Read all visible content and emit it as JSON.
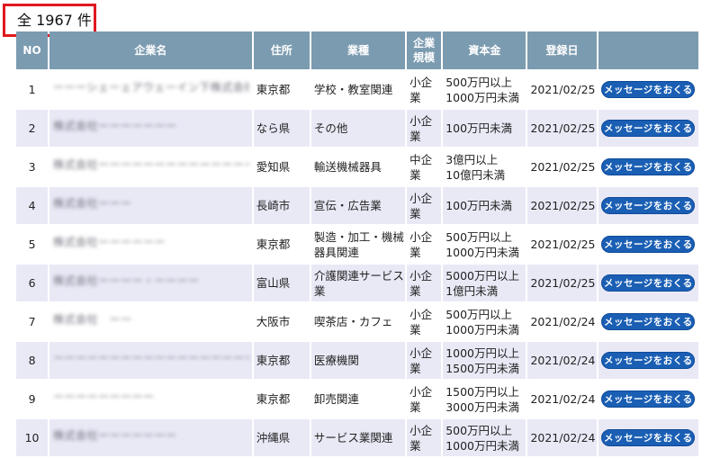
{
  "total_label": "全 1967 件",
  "headers": {
    "no": "NO",
    "company": "企業名",
    "address": "住所",
    "industry": "業種",
    "size": "企業\n規模",
    "capital": "資本金",
    "date": "登録日",
    "action": ""
  },
  "rows": [
    {
      "no": "1",
      "company": "ーーーシェーェアウェーイン下株式会社",
      "address": "東京都",
      "industry": "学校・教室関連",
      "size": "小企\n業",
      "capital": "500万円以上\n1000万円未満",
      "date": "2021/02/25",
      "button": "メッセージをおくる"
    },
    {
      "no": "2",
      "company": "株式会社ーーーーーーー",
      "address": "なら県",
      "industry": "その他",
      "size": "小企\n業",
      "capital": "100万円未満",
      "date": "2021/02/25",
      "button": "メッセージをおくる"
    },
    {
      "no": "3",
      "company": "株式会社ーーーーーーーーーーーーーー 株",
      "address": "愛知県",
      "industry": "輸送機械器具",
      "size": "中企\n業",
      "capital": "3億円以上\n10億円未満",
      "date": "2021/02/25",
      "button": "メッセージをおくる"
    },
    {
      "no": "4",
      "company": "株式会社ーーー",
      "address": "長崎市",
      "industry": "宣伝・広告業",
      "size": "小企\n業",
      "capital": "100万円未満",
      "date": "2021/02/25",
      "button": "メッセージをおくる"
    },
    {
      "no": "5",
      "company": "株式会社ーーーーーー",
      "address": "東京都",
      "industry": "製造・加工・機械\n器具関連",
      "size": "小企\n業",
      "capital": "500万円以上\n1000万円未満",
      "date": "2021/02/25",
      "button": "メッセージをおくる"
    },
    {
      "no": "6",
      "company": "株式会社ーーーー・ーーーー",
      "address": "富山県",
      "industry": "介護関連サービス\n業",
      "size": "小企\n業",
      "capital": "5000万円以上\n1億円未満",
      "date": "2021/02/25",
      "button": "メッセージをおくる"
    },
    {
      "no": "7",
      "company": "株式会社　ーー",
      "address": "大阪市",
      "industry": "喫茶店・カフェ",
      "size": "小企\n業",
      "capital": "500万円以上\n1000万円未満",
      "date": "2021/02/24",
      "button": "メッセージをおくる"
    },
    {
      "no": "8",
      "company": "ーーーーーーーーーーーーーーーーーー",
      "address": "東京都",
      "industry": "医療機関",
      "size": "小企\n業",
      "capital": "1000万円以上\n1500万円未満",
      "date": "2021/02/24",
      "button": "メッセージをおくる"
    },
    {
      "no": "9",
      "company": "ーーーーーーーーー",
      "address": "東京都",
      "industry": "卸売関連",
      "size": "小企\n業",
      "capital": "1500万円以上\n3000万円未満",
      "date": "2021/02/24",
      "button": "メッセージをおくる"
    },
    {
      "no": "10",
      "company": "株式会社ーーーーーーー",
      "address": "沖縄県",
      "industry": "サービス業関連",
      "size": "小企\n業",
      "capital": "500万円以上\n1000万円未満",
      "date": "2021/02/24",
      "button": "メッセージをおくる"
    }
  ],
  "colors": {
    "header_bg": "#7b9bb0",
    "row_alt_bg": "#e9e9f6",
    "button_bg": "#1a5fb4",
    "highlight_border": "#e0191f"
  }
}
